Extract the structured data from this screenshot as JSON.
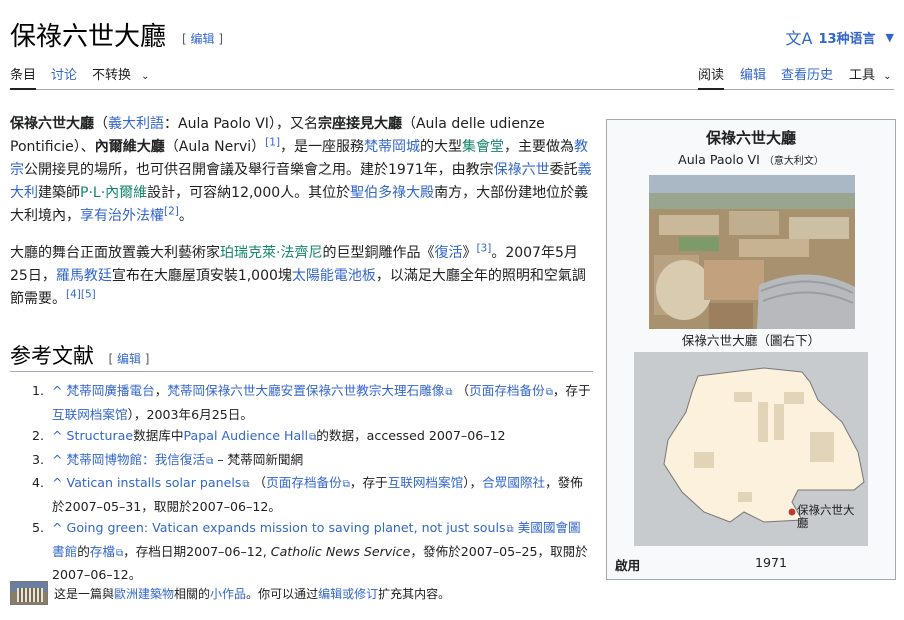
{
  "page": {
    "title": "保祿六世大廳",
    "edit_label": "编辑",
    "lang_label": "13种语言"
  },
  "tabs": {
    "article": "条目",
    "talk": "讨论",
    "variant": "不转换",
    "read": "阅读",
    "edit": "编辑",
    "history": "查看历史",
    "tools": "工具"
  },
  "intro": {
    "p1": [
      {
        "t": "保祿六世大廳",
        "b": true
      },
      {
        "t": "（"
      },
      {
        "t": "義大利語",
        "l": true
      },
      {
        "t": "：Aula Paolo VI），又名"
      },
      {
        "t": "宗座接見大廳",
        "b": true
      },
      {
        "t": "（Aula delle udienze Pontificie）、"
      },
      {
        "t": "內爾維大廳",
        "b": true
      },
      {
        "t": "（Aula Nervi）"
      },
      {
        "t": "[1]",
        "s": true
      },
      {
        "t": "，是一座服務"
      },
      {
        "t": "梵蒂岡城",
        "l": true
      },
      {
        "t": "的大型"
      },
      {
        "t": "集會堂",
        "g": true
      },
      {
        "t": "，主要做為"
      },
      {
        "t": "教宗",
        "l": true
      },
      {
        "t": "公開接見的場所，也可供召開會議及舉行音樂會之用。建於1971年，由教宗"
      },
      {
        "t": "保祿六世",
        "l": true
      },
      {
        "t": "委託"
      },
      {
        "t": "義大利",
        "l": true
      },
      {
        "t": "建築師"
      },
      {
        "t": "P·L·內爾維",
        "g": true
      },
      {
        "t": "設計，可容納12,000人。其位於"
      },
      {
        "t": "聖伯多祿大殿",
        "l": true
      },
      {
        "t": "南方，大部份建地位於義大利境內，"
      },
      {
        "t": "享有治外法權",
        "l": true
      },
      {
        "t": "[2]",
        "s": true
      },
      {
        "t": "。"
      }
    ],
    "p2": [
      {
        "t": "大廳的舞台正面放置義大利藝術家"
      },
      {
        "t": "珀瑞克萊·法齊尼",
        "g": true
      },
      {
        "t": "的巨型銅雕作品《"
      },
      {
        "t": "復活",
        "l": true
      },
      {
        "t": "》"
      },
      {
        "t": "[3]",
        "s": true
      },
      {
        "t": "。2007年5月25日，"
      },
      {
        "t": "羅馬教廷",
        "l": true
      },
      {
        "t": "宣布在大廳屋頂安裝1,000塊"
      },
      {
        "t": "太陽能電池板",
        "l": true
      },
      {
        "t": "，以滿足大廳全年的照明和空氣調節需要。"
      },
      {
        "t": "[4][5]",
        "s": true
      }
    ]
  },
  "references": {
    "heading": "参考文献",
    "edit_label": "编辑",
    "items": [
      {
        "num": "1.",
        "parts": [
          {
            "t": "^ 梵蒂岡廣播電台",
            "l": true
          },
          {
            "t": "，"
          },
          {
            "t": "梵蒂岡保祿六世大廳安置保祿六世教宗大理石雕像",
            "e": true
          },
          {
            "t": " （"
          },
          {
            "t": "页面存档备份",
            "e": true
          },
          {
            "t": "，存于"
          },
          {
            "t": "互联网档案馆",
            "l": true
          },
          {
            "t": "），2003年6月25日。"
          }
        ]
      },
      {
        "num": "2.",
        "parts": [
          {
            "t": "^ Structurae",
            "l": true
          },
          {
            "t": "数据库中"
          },
          {
            "t": "Papal Audience Hall",
            "e": true
          },
          {
            "t": "的数据，accessed 2007–06–12"
          }
        ]
      },
      {
        "num": "3.",
        "parts": [
          {
            "t": "^ 梵蒂岡博物館：我信復活",
            "e": true
          },
          {
            "t": " – 梵蒂岡新聞網"
          }
        ]
      },
      {
        "num": "4.",
        "parts": [
          {
            "t": "^ Vatican installs solar panels",
            "e": true
          },
          {
            "t": " （"
          },
          {
            "t": "页面存档备份",
            "e": true
          },
          {
            "t": "，存于"
          },
          {
            "t": "互联网档案馆",
            "l": true
          },
          {
            "t": "），"
          },
          {
            "t": "合眾國際社",
            "l": true
          },
          {
            "t": "，發佈於2007–05–31，取閱於2007–06–12。"
          }
        ]
      },
      {
        "num": "5.",
        "parts": [
          {
            "t": "^ Going green: Vatican expands mission to saving planet, not just souls",
            "e": true
          },
          {
            "t": " "
          },
          {
            "t": "美國國會圖書館",
            "l": true
          },
          {
            "t": "的"
          },
          {
            "t": "存檔",
            "e": true
          },
          {
            "t": "，存档日期2007–06–12, "
          },
          {
            "t": "Catholic News Service",
            "i": true
          },
          {
            "t": "，發佈於2007–05–25，取閱於2007–06–12。"
          }
        ]
      }
    ]
  },
  "stub": [
    {
      "t": "这是一篇與"
    },
    {
      "t": "歐洲建築物",
      "l": true
    },
    {
      "t": "相關的"
    },
    {
      "t": "小作品",
      "l": true
    },
    {
      "t": "。你可以通过"
    },
    {
      "t": "编辑或修订",
      "l": true
    },
    {
      "t": "扩充其内容。"
    }
  ],
  "infobox": {
    "title": "保祿六世大廳",
    "subtitle": "Aula Paolo VI",
    "subtitle_note": "（意大利文）",
    "photo_caption": "保祿六世大廳（圖右下）",
    "map_label": "保祿六世大廳",
    "opened_label": "啟用",
    "opened_value": "1971"
  },
  "colors": {
    "link": "#3366cc",
    "green_link": "#14866d",
    "infobox_bg": "#f8f9fa"
  }
}
